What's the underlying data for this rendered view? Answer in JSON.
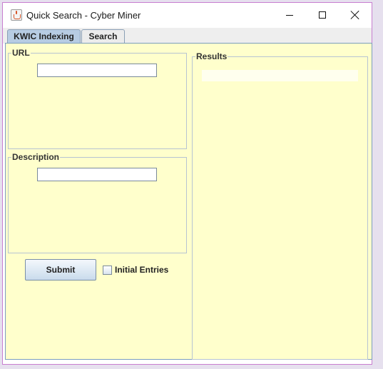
{
  "window": {
    "title": "Quick Search - Cyber Miner",
    "icon": "java-cup-icon",
    "controls": [
      "minimize-icon",
      "maximize-icon",
      "close-icon"
    ]
  },
  "tabs": [
    {
      "label": "KWIC Indexing",
      "selected": true
    },
    {
      "label": "Search",
      "selected": false
    }
  ],
  "url_section": {
    "legend": "URL",
    "value": ""
  },
  "description_section": {
    "legend": "Description",
    "value": ""
  },
  "results_section": {
    "legend": "Results",
    "items": []
  },
  "submit_label": "Submit",
  "initial_entries": {
    "label": "Initial Entries",
    "checked": false
  },
  "colors": {
    "panel_background": "#ffffcc",
    "selected_tab": "#b7cce3",
    "border": "#7b9ebd"
  }
}
